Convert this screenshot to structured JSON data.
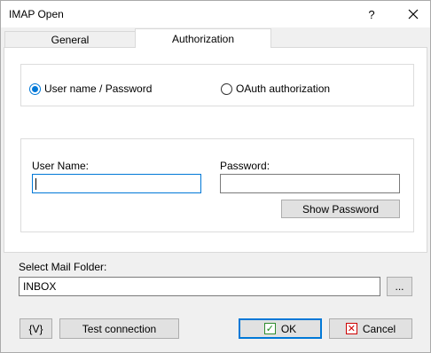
{
  "window": {
    "title": "IMAP Open",
    "help_label": "?",
    "close_label": "✕"
  },
  "tabs": [
    {
      "label": "General",
      "active": false
    },
    {
      "label": "Authorization",
      "active": true
    }
  ],
  "auth": {
    "mode_options": [
      {
        "label": "User name / Password",
        "checked": true
      },
      {
        "label": "OAuth authorization",
        "checked": false
      }
    ],
    "username_label": "User Name:",
    "username_value": "",
    "password_label": "Password:",
    "password_value": "",
    "show_password_label": "Show Password"
  },
  "mail_folder": {
    "label": "Select Mail Folder:",
    "value": "INBOX",
    "browse_label": "..."
  },
  "footer": {
    "variables_label": "{V}",
    "test_connection_label": "Test connection",
    "ok_label": "OK",
    "cancel_label": "Cancel",
    "ok_icon": "checkmark-icon",
    "cancel_icon": "x-icon"
  },
  "colors": {
    "accent": "#0078d7",
    "ok_green": "#1c8a1c",
    "cancel_red": "#d00000"
  }
}
